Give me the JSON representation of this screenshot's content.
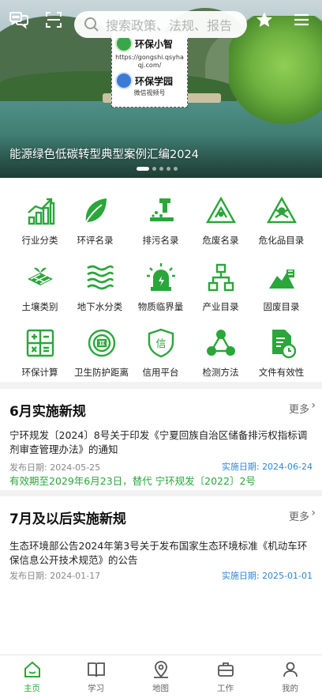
{
  "search": {
    "placeholder": "搜索政策、法规、报告"
  },
  "banner": {
    "title": "能源绿色低碳转型典型案例汇编2024",
    "card": {
      "name1": "环保小智",
      "url": "https://gongshi.qsyhaqj.com/",
      "name2": "环保学园",
      "caption": "微信视频号"
    },
    "dots": 5,
    "active_dot": 0
  },
  "grid": [
    {
      "label": "行业分类",
      "icon": "bar-chart-icon"
    },
    {
      "label": "环评名录",
      "icon": "leaf-icon"
    },
    {
      "label": "排污名录",
      "icon": "discharge-pipe-icon"
    },
    {
      "label": "危废名录",
      "icon": "hazard-warning-icon"
    },
    {
      "label": "危化品目录",
      "icon": "chemical-hazard-icon"
    },
    {
      "label": "土壤类别",
      "icon": "soil-icon"
    },
    {
      "label": "地下水分类",
      "icon": "water-waves-icon"
    },
    {
      "label": "物质临界量",
      "icon": "alarm-light-icon"
    },
    {
      "label": "产业目录",
      "icon": "hierarchy-icon"
    },
    {
      "label": "固废目录",
      "icon": "waste-pile-icon"
    },
    {
      "label": "环保计算",
      "icon": "calculator-icon"
    },
    {
      "label": "卫生防护距离",
      "icon": "distance-target-icon"
    },
    {
      "label": "信用平台",
      "icon": "credit-shield-icon"
    },
    {
      "label": "检测方法",
      "icon": "network-nodes-icon"
    },
    {
      "label": "文件有效性",
      "icon": "document-clock-icon"
    }
  ],
  "section1": {
    "title": "6月实施新规",
    "more": "更多",
    "item": {
      "title": "宁环规发〔2024〕8号关于印发《宁夏回族自治区储备排污权指标调剂审查管理办法》的通知",
      "publish_label": "发布日期:",
      "publish_date": "2024-05-25",
      "effective_label": "实施日期:",
      "effective_date": "2024-06-24",
      "note": "有效期至2029年6月23日，替代 宁环规发〔2022〕2号"
    }
  },
  "section2": {
    "title": "7月及以后实施新规",
    "more": "更多",
    "item": {
      "title": "生态环境部公告2024年第3号关于发布国家生态环境标准《机动车环保信息公开技术规范》的公告",
      "publish_label": "发布日期:",
      "publish_date": "2024-01-17",
      "effective_label": "实施日期:",
      "effective_date": "2025-01-01"
    }
  },
  "tabs": [
    {
      "label": "主页",
      "icon": "home-icon",
      "active": true
    },
    {
      "label": "学习",
      "icon": "book-icon",
      "active": false
    },
    {
      "label": "地图",
      "icon": "map-pin-icon",
      "active": false
    },
    {
      "label": "工作",
      "icon": "briefcase-icon",
      "active": false
    },
    {
      "label": "我的",
      "icon": "user-icon",
      "active": false
    }
  ],
  "colors": {
    "accent": "#2aa63a",
    "link": "#2b87d6"
  }
}
